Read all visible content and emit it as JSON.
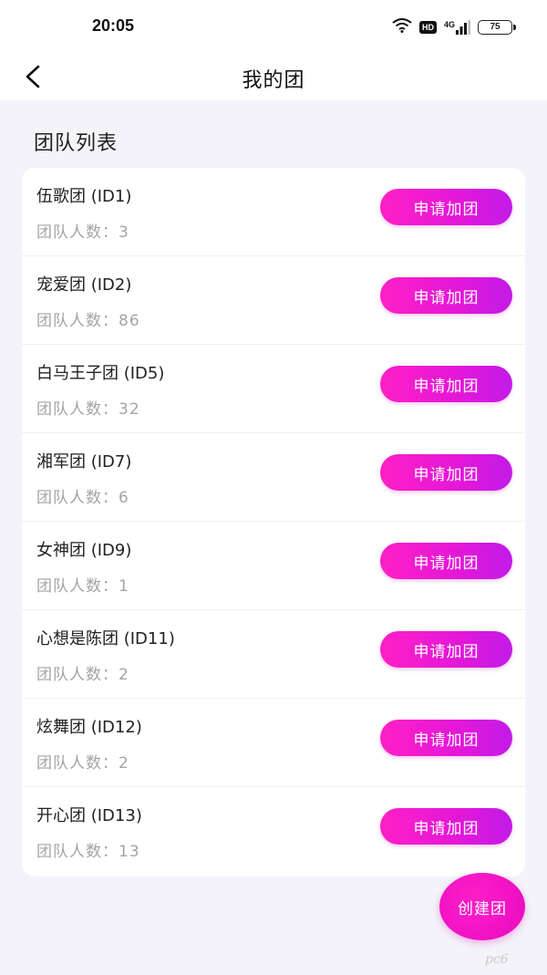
{
  "status_bar": {
    "time": "20:05",
    "hd_badge": "HD",
    "network_label": "4G",
    "battery_level": "75",
    "icons": [
      "wifi-icon",
      "hd-icon",
      "signal-icon",
      "battery-icon"
    ]
  },
  "nav": {
    "back_icon": "chevron-left-icon",
    "title": "我的团"
  },
  "section": {
    "title": "团队列表"
  },
  "teams": [
    {
      "name": "伍歌团 (ID1)",
      "count": "团队人数：3",
      "action": "申请加团"
    },
    {
      "name": "宠爱团 (ID2)",
      "count": "团队人数：86",
      "action": "申请加团"
    },
    {
      "name": "白马王子团 (ID5)",
      "count": "团队人数：32",
      "action": "申请加团"
    },
    {
      "name": "湘军团 (ID7)",
      "count": "团队人数：6",
      "action": "申请加团"
    },
    {
      "name": "女神团 (ID9)",
      "count": "团队人数：1",
      "action": "申请加团"
    },
    {
      "name": "心想是陈团 (ID11)",
      "count": "团队人数：2",
      "action": "申请加团"
    },
    {
      "name": "炫舞团 (ID12)",
      "count": "团队人数：2",
      "action": "申请加团"
    },
    {
      "name": "开心团 (ID13)",
      "count": "团队人数：13",
      "action": "申请加团"
    }
  ],
  "fab": {
    "label": "创建团"
  },
  "watermark": {
    "text": "pc6"
  },
  "colors": {
    "accent": "#f012c4",
    "accent_end": "#c21be8",
    "background": "#f3f3f9",
    "muted_text": "#a4a4a4"
  }
}
